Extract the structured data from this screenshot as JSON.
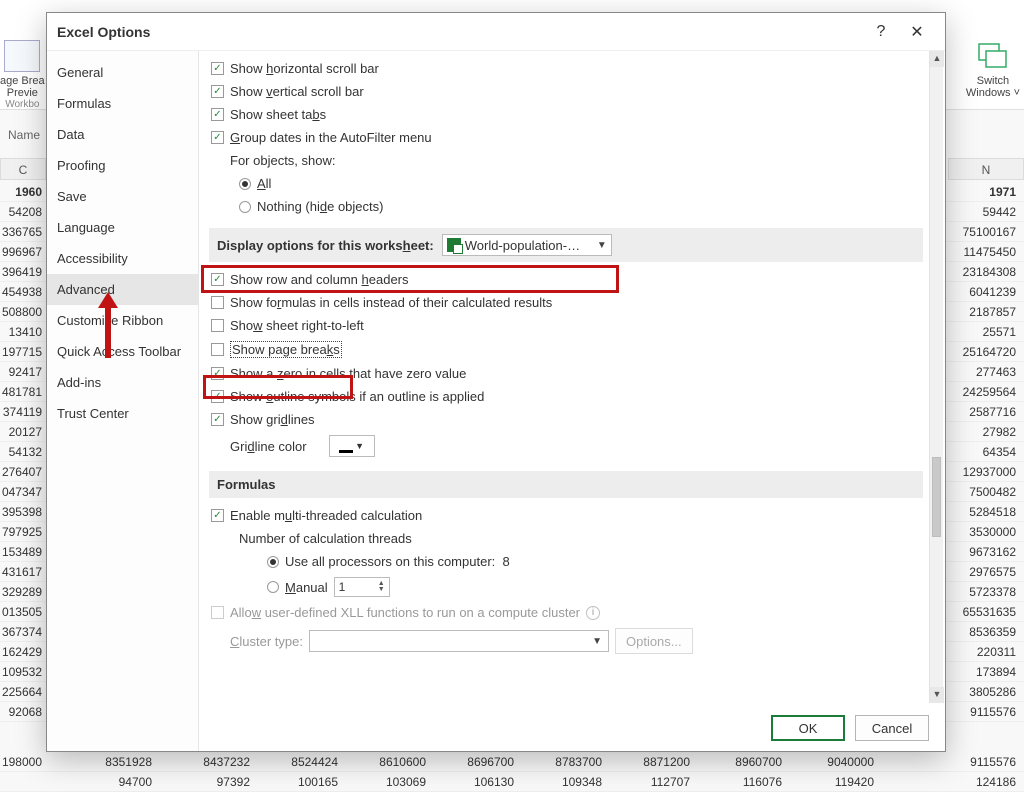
{
  "ribbon": {
    "page_break_label1": "age Brea",
    "page_break_label2": "Previe",
    "workbook_label": "Workbo",
    "switch_windows_label1": "Switch",
    "switch_windows_label2": "Windows ˅"
  },
  "name_box": {
    "label": "Name"
  },
  "columns": {
    "left": "C",
    "right": "N"
  },
  "grid": {
    "header": {
      "left": "1960",
      "right": "1971"
    },
    "rows": [
      {
        "left": "54208",
        "right": "59442"
      },
      {
        "left": "336765",
        "right": "75100167"
      },
      {
        "left": "996967",
        "right": "11475450"
      },
      {
        "left": "396419",
        "right": "23184308"
      },
      {
        "left": "454938",
        "right": "6041239"
      },
      {
        "left": "508800",
        "right": "2187857"
      },
      {
        "left": "13410",
        "right": "25571"
      },
      {
        "left": "197715",
        "right": "25164720"
      },
      {
        "left": "92417",
        "right": "277463"
      },
      {
        "left": "481781",
        "right": "24259564"
      },
      {
        "left": "374119",
        "right": "2587716"
      },
      {
        "left": "20127",
        "right": "27982"
      },
      {
        "left": "54132",
        "right": "64354"
      },
      {
        "left": "276407",
        "right": "12937000"
      },
      {
        "left": "047347",
        "right": "7500482"
      },
      {
        "left": "395398",
        "right": "5284518"
      },
      {
        "left": "797925",
        "right": "3530000"
      },
      {
        "left": "153489",
        "right": "9673162"
      },
      {
        "left": "431617",
        "right": "2976575"
      },
      {
        "left": "329289",
        "right": "5723378"
      },
      {
        "left": "013505",
        "right": "65531635"
      },
      {
        "left": "367374",
        "right": "8536359"
      },
      {
        "left": "162429",
        "right": "220311"
      },
      {
        "left": "109532",
        "right": "173894"
      },
      {
        "left": "225664",
        "right": "3805286"
      },
      {
        "left": "92068",
        "right": "9115576"
      }
    ]
  },
  "extra_rows": [
    {
      "left": "198000",
      "cols": [
        "8351928",
        "8437232",
        "8524424",
        "8610600",
        "8696700",
        "8783700",
        "8871200",
        "8960700",
        "9040000"
      ],
      "right": "9115576"
    },
    {
      "left": "",
      "cols": [
        "94700",
        "97392",
        "100165",
        "103069",
        "106130",
        "109348",
        "112707",
        "116076",
        "119420"
      ],
      "right": "124186"
    }
  ],
  "dialog": {
    "title": "Excel Options",
    "help_aria": "Help",
    "close_aria": "Close"
  },
  "nav": {
    "items": [
      "General",
      "Formulas",
      "Data",
      "Proofing",
      "Save",
      "Language",
      "Accessibility",
      "Advanced",
      "Customize Ribbon",
      "Quick Access Toolbar",
      "Add-ins",
      "Trust Center"
    ],
    "selected_index": 7
  },
  "workbook_display": {
    "show_h_scroll": {
      "label_pre": "Show ",
      "u": "h",
      "label_post": "orizontal scroll bar",
      "checked": true
    },
    "show_v_scroll": {
      "label_pre": "Show ",
      "u": "v",
      "label_post": "ertical scroll bar",
      "checked": true
    },
    "show_sheet_tabs": {
      "label_pre": "Show sheet ta",
      "u": "b",
      "label_post": "s",
      "checked": true
    },
    "group_dates": {
      "label_pre": "",
      "u": "G",
      "label_post": "roup dates in the AutoFilter menu",
      "checked": true
    },
    "for_objects_label": "For objects, show:",
    "all_option": {
      "u": "A",
      "label_post": "ll",
      "checked": true
    },
    "nothing_option": {
      "label_pre": "Nothing (hi",
      "u": "d",
      "label_post": "e objects)",
      "checked": false
    }
  },
  "worksheet_section": {
    "heading_pre": "Display options for this works",
    "heading_u": "h",
    "heading_post": "eet:",
    "worksheet_name": "World-population-…",
    "show_headers": {
      "label_pre": "Show row and column ",
      "u": "h",
      "label_post": "eaders",
      "checked": true
    },
    "show_formulas": {
      "label_pre": "Show fo",
      "u": "r",
      "label_post": "mulas in cells instead of their calculated results",
      "checked": false
    },
    "sheet_rtl": {
      "label_pre": "Sho",
      "u": "w",
      "label_post": " sheet right-to-left",
      "checked": false
    },
    "page_breaks": {
      "label_pre": "Show page brea",
      "u": "k",
      "label_post": "s",
      "checked": false
    },
    "show_zero": {
      "label_pre": "Show a ",
      "u": "z",
      "label_post": "ero in cells that have zero value",
      "checked": true
    },
    "outline": {
      "label_pre": "Show ",
      "u": "o",
      "label_post": "utline symbols if an outline is applied",
      "checked": true
    },
    "gridlines": {
      "label_pre": "Show gri",
      "u": "d",
      "label_post": "lines",
      "checked": true
    },
    "gridline_color_label_pre": "Gri",
    "gridline_color_u": "d",
    "gridline_color_post": "line color"
  },
  "formulas_section": {
    "heading": "Formulas",
    "enable_mt": {
      "label_pre": "Enable m",
      "u": "u",
      "label_post": "lti-threaded calculation",
      "checked": true
    },
    "threads_label": "Number of calculation threads",
    "all_proc": {
      "label": "Use all processors on this computer:",
      "value": "8",
      "checked": true
    },
    "manual": {
      "u": "M",
      "label_post": "anual",
      "value": "1",
      "checked": false
    },
    "xll_cluster": {
      "label_pre": "Allo",
      "u": "w",
      "label_post": " user-defined XLL functions to run on a compute cluster",
      "enabled": false
    },
    "cluster_type_label_pre": "",
    "cluster_type_u": "C",
    "cluster_type_post": "luster type:",
    "options_btn": "Options..."
  },
  "footer": {
    "ok": "OK",
    "cancel": "Cancel"
  }
}
